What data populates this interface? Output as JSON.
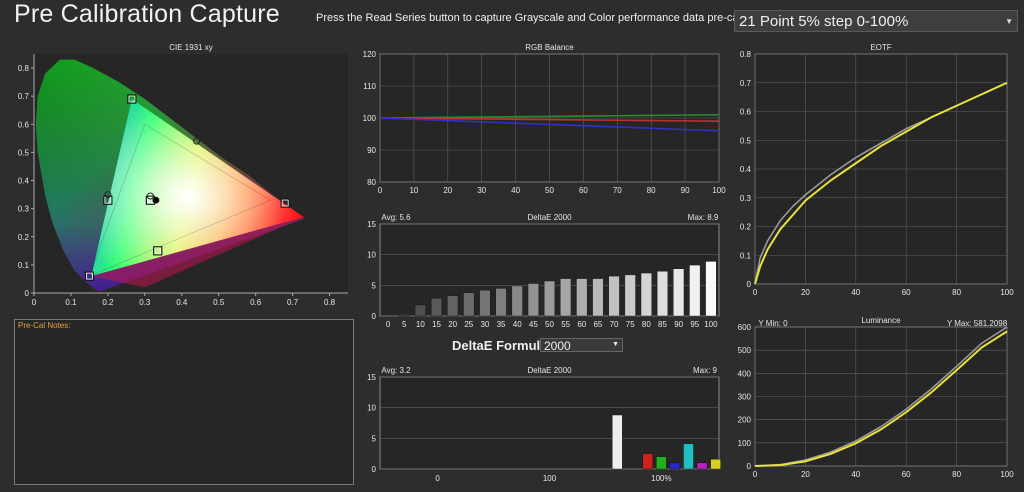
{
  "header": {
    "title": "Pre Calibration Capture",
    "instruction": "Press the Read Series button to capture Grayscale and Color performance data pre-calibration.",
    "series_select": "21 Point 5% step 0-100%"
  },
  "notes": {
    "label": "Pre-Cal Notes:"
  },
  "deltae_formula": {
    "label": "DeltaE Formula",
    "value": "2000"
  },
  "colors": {
    "grid": "#606060",
    "plot_bg": "#262626",
    "yellow": "#e8e23a",
    "gray_curve": "#9a9a9a"
  },
  "chart_data": [
    {
      "id": "cie",
      "type": "scatter",
      "title": "CIE 1931 xy",
      "xlim": [
        0,
        0.85
      ],
      "ylim": [
        0,
        0.85
      ],
      "xticks": [
        "0",
        "0.1",
        "0.2",
        "0.3",
        "0.4",
        "0.5",
        "0.6",
        "0.7",
        "0.8"
      ],
      "yticks": [
        "0",
        "0.1",
        "0.2",
        "0.3",
        "0.4",
        "0.5",
        "0.6",
        "0.7",
        "0.8"
      ],
      "target_gamut": [
        [
          0.64,
          0.33
        ],
        [
          0.3,
          0.6
        ],
        [
          0.15,
          0.06
        ]
      ],
      "measured_gamut": [
        [
          0.73,
          0.27
        ],
        [
          0.265,
          0.69
        ],
        [
          0.155,
          0.06
        ]
      ],
      "targets": [
        [
          0.68,
          0.32
        ],
        [
          0.265,
          0.69
        ],
        [
          0.15,
          0.06
        ],
        [
          0.2,
          0.33
        ],
        [
          0.315,
          0.33
        ],
        [
          0.335,
          0.15
        ]
      ],
      "measured": [
        [
          0.44,
          0.54
        ],
        [
          0.2,
          0.35
        ],
        [
          0.315,
          0.345
        ],
        [
          0.33,
          0.33
        ]
      ]
    },
    {
      "id": "rgb",
      "type": "line",
      "title": "RGB Balance",
      "xlim": [
        0,
        100
      ],
      "ylim": [
        80,
        120
      ],
      "xticks": [
        "0",
        "10",
        "20",
        "30",
        "40",
        "50",
        "60",
        "70",
        "80",
        "90",
        "100"
      ],
      "yticks": [
        "80",
        "90",
        "100",
        "110",
        "120"
      ],
      "x": [
        0,
        10,
        20,
        30,
        40,
        50,
        60,
        70,
        80,
        90,
        100
      ],
      "series": [
        {
          "color": "#2d8a2d",
          "values": [
            100,
            100.1,
            100.2,
            100.3,
            100.4,
            100.5,
            100.6,
            100.7,
            100.8,
            100.9,
            101
          ]
        },
        {
          "color": "#c03030",
          "values": [
            100,
            99.9,
            99.8,
            99.7,
            99.6,
            99.5,
            99.4,
            99.3,
            99.2,
            99.1,
            99
          ]
        },
        {
          "color": "#3030c8",
          "values": [
            100,
            99.6,
            99.2,
            98.8,
            98.4,
            98,
            97.6,
            97.2,
            96.8,
            96.4,
            96
          ]
        }
      ]
    },
    {
      "id": "de1",
      "type": "bar",
      "title": "DeltaE 2000",
      "avg": "Avg: 5.6",
      "max": "Max: 8.9",
      "ylim": [
        0,
        15
      ],
      "yticks": [
        "0",
        "5",
        "10",
        "15"
      ],
      "categories": [
        "0",
        "5",
        "10",
        "15",
        "20",
        "25",
        "30",
        "35",
        "40",
        "45",
        "50",
        "55",
        "60",
        "65",
        "70",
        "75",
        "80",
        "85",
        "90",
        "95",
        "100"
      ],
      "values": [
        0,
        0.3,
        1.8,
        2.9,
        3.3,
        3.8,
        4.2,
        4.5,
        4.9,
        5.3,
        5.7,
        6.1,
        6.1,
        6.1,
        6.5,
        6.7,
        7.0,
        7.3,
        7.7,
        8.3,
        8.9
      ]
    },
    {
      "id": "de2",
      "type": "bar",
      "title": "DeltaE 2000",
      "avg": "Avg: 3.2",
      "max": "Max: 9",
      "ylim": [
        0,
        15
      ],
      "yticks": [
        "0",
        "5",
        "10",
        "15"
      ],
      "xlabels": [
        "0",
        "100",
        "100%"
      ],
      "bars": [
        {
          "pos": 0.7,
          "value": 8.8,
          "color": "#eeeeee"
        },
        {
          "pos": 0.79,
          "value": 2.5,
          "color": "#d02020"
        },
        {
          "pos": 0.83,
          "value": 2.0,
          "color": "#20b020"
        },
        {
          "pos": 0.87,
          "value": 1.0,
          "color": "#2828d0"
        },
        {
          "pos": 0.91,
          "value": 4.1,
          "color": "#20c0c0"
        },
        {
          "pos": 0.95,
          "value": 1.0,
          "color": "#c020c0"
        },
        {
          "pos": 0.99,
          "value": 1.6,
          "color": "#d8d020"
        }
      ]
    },
    {
      "id": "eotf",
      "type": "line",
      "title": "EOTF",
      "xlim": [
        0,
        100
      ],
      "ylim": [
        0,
        0.8
      ],
      "xticks": [
        "0",
        "20",
        "40",
        "60",
        "80",
        "100"
      ],
      "yticks": [
        "0",
        "0.1",
        "0.2",
        "0.3",
        "0.4",
        "0.5",
        "0.6",
        "0.7",
        "0.8"
      ],
      "x": [
        0,
        2,
        5,
        10,
        15,
        20,
        30,
        40,
        50,
        60,
        70,
        80,
        90,
        100
      ],
      "series": [
        {
          "name": "target",
          "color": "#9a9a9a",
          "values": [
            0,
            0.09,
            0.15,
            0.22,
            0.27,
            0.31,
            0.38,
            0.44,
            0.49,
            0.54,
            0.58,
            0.62,
            0.66,
            0.7
          ]
        },
        {
          "name": "measured",
          "color": "#e8e23a",
          "values": [
            0,
            0.06,
            0.12,
            0.19,
            0.24,
            0.29,
            0.36,
            0.42,
            0.48,
            0.53,
            0.58,
            0.62,
            0.66,
            0.7
          ]
        }
      ]
    },
    {
      "id": "lum",
      "type": "line",
      "title": "Luminance",
      "ymin_label": "Y Min: 0",
      "ymax_label": "Y Max: 581.2098",
      "xlim": [
        0,
        100
      ],
      "ylim": [
        0,
        600
      ],
      "xticks": [
        "0",
        "20",
        "40",
        "60",
        "80",
        "100"
      ],
      "yticks": [
        "0",
        "100",
        "200",
        "300",
        "400",
        "500",
        "600"
      ],
      "x": [
        0,
        10,
        20,
        30,
        40,
        50,
        60,
        70,
        80,
        90,
        100
      ],
      "series": [
        {
          "name": "target",
          "color": "#9a9a9a",
          "values": [
            0,
            6,
            26,
            60,
            108,
            170,
            245,
            333,
            430,
            530,
            600
          ]
        },
        {
          "name": "measured",
          "color": "#e8e23a",
          "values": [
            0,
            4,
            20,
            52,
            98,
            158,
            232,
            318,
            414,
            512,
            581
          ]
        }
      ]
    }
  ]
}
